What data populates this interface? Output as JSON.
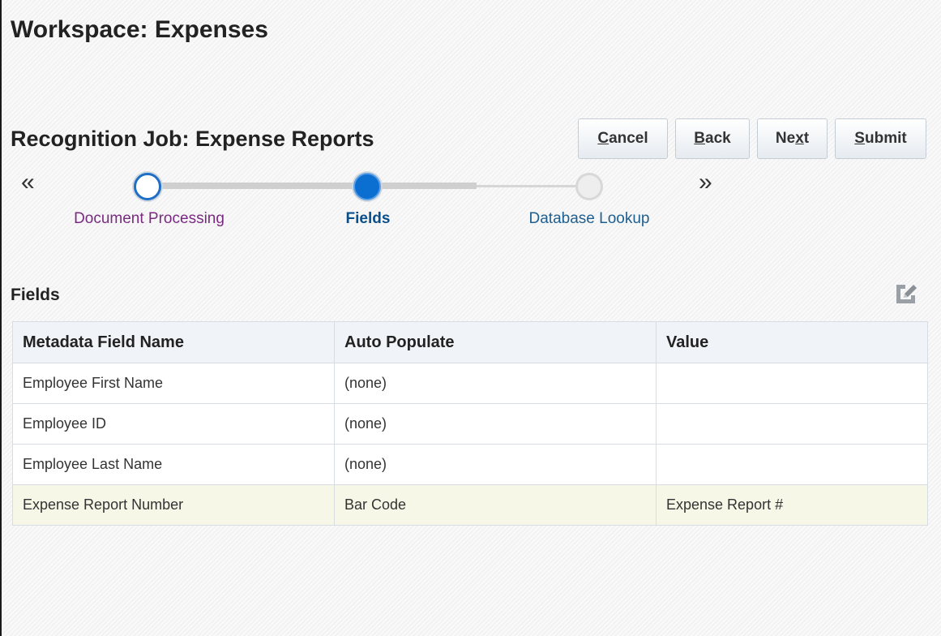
{
  "workspace": {
    "title": "Workspace: Expenses"
  },
  "job": {
    "title": "Recognition Job: Expense Reports"
  },
  "buttons": {
    "cancel": {
      "accel": "C",
      "rest": "ancel"
    },
    "back": {
      "accel": "B",
      "rest": "ack"
    },
    "next": {
      "pre": "Ne",
      "accel": "x",
      "rest": "t"
    },
    "submit": {
      "accel": "S",
      "rest": "ubmit"
    }
  },
  "train": {
    "prev_arrow": "«",
    "next_arrow": "»",
    "stops": [
      {
        "label": "Document Processing",
        "state": "visited"
      },
      {
        "label": "Fields",
        "state": "current"
      },
      {
        "label": "Database Lookup",
        "state": "future"
      }
    ]
  },
  "fields_section": {
    "title": "Fields",
    "edit_icon": "edit-icon"
  },
  "table": {
    "headers": [
      "Metadata Field Name",
      "Auto Populate",
      "Value"
    ],
    "rows": [
      [
        "Employee First Name",
        "(none)",
        ""
      ],
      [
        "Employee ID",
        "(none)",
        ""
      ],
      [
        "Employee Last Name",
        "(none)",
        ""
      ],
      [
        "Expense Report Number",
        "Bar Code",
        "Expense Report #"
      ]
    ],
    "selected_row": 3
  },
  "colors": {
    "accent": "#0b6fd1",
    "visited_label": "#7a2a82",
    "selected_row": "#f7f7e8"
  }
}
